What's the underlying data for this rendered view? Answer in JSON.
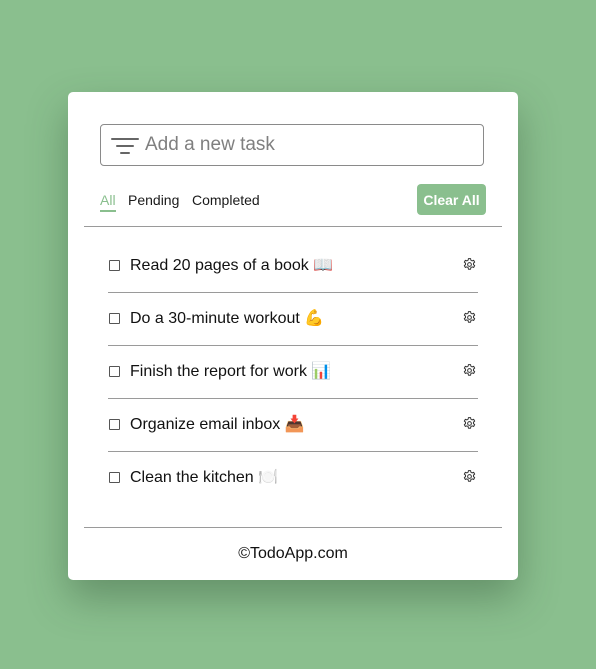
{
  "colors": {
    "background": "#8abf8e",
    "accent": "#8abf8e",
    "card": "#ffffff"
  },
  "input": {
    "placeholder": "Add a new task",
    "value": "",
    "icon": "filter-lines-icon"
  },
  "filters": {
    "tabs": [
      {
        "label": "All",
        "active": true
      },
      {
        "label": "Pending",
        "active": false
      },
      {
        "label": "Completed",
        "active": false
      }
    ],
    "clear_label": "Clear All"
  },
  "tasks": [
    {
      "text": "Read 20 pages of a book 📖",
      "checked": false,
      "icon": "gear-icon"
    },
    {
      "text": "Do a 30-minute workout 💪",
      "checked": false,
      "icon": "gear-icon"
    },
    {
      "text": "Finish the report for work 📊",
      "checked": false,
      "icon": "gear-icon"
    },
    {
      "text": "Organize email inbox 📥",
      "checked": false,
      "icon": "gear-icon"
    },
    {
      "text": "Clean the kitchen 🍽️",
      "checked": false,
      "icon": "gear-icon"
    }
  ],
  "footer": {
    "text": "©TodoApp.com"
  }
}
